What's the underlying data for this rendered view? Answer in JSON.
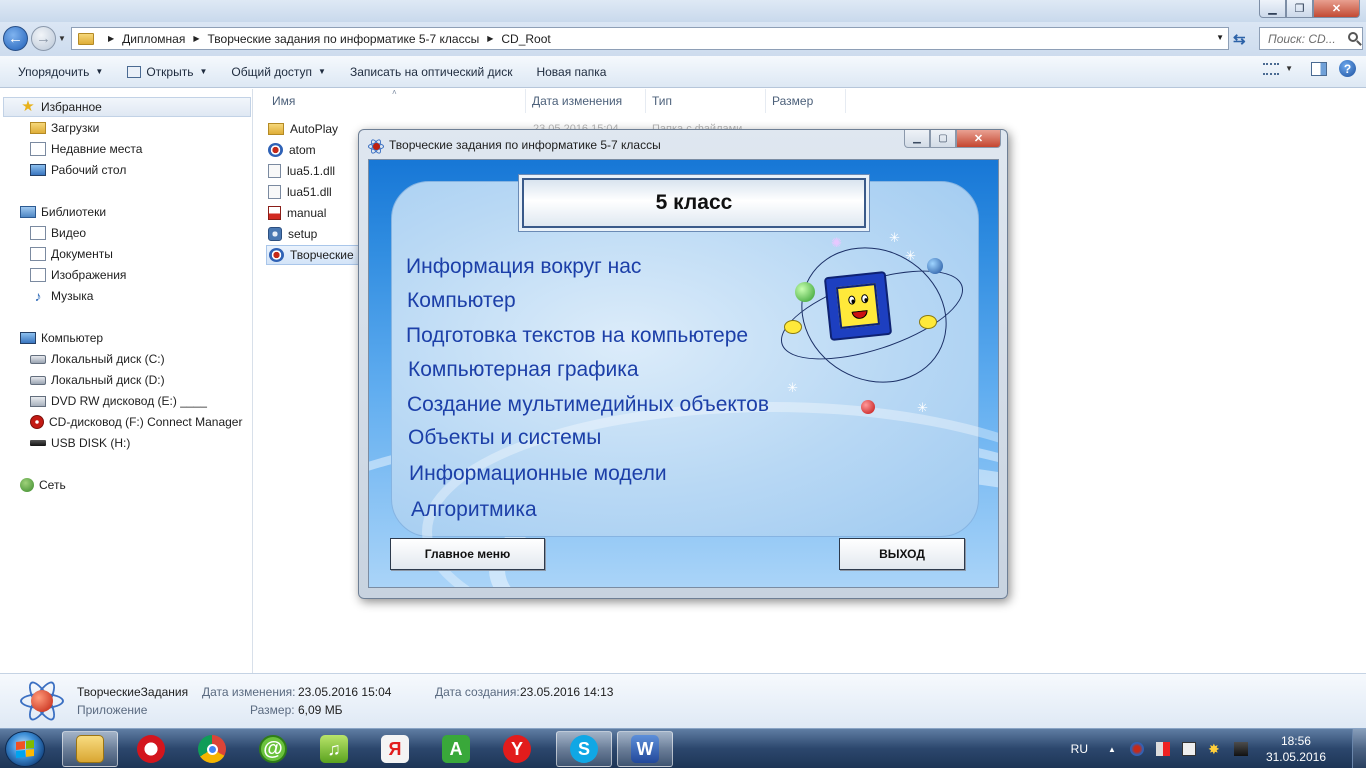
{
  "explorer": {
    "breadcrumb": [
      "Дипломная",
      "Творческие задания по информатике 5-7 классы",
      "CD_Root"
    ],
    "search_placeholder": "Поиск: CD...",
    "toolbar": {
      "organize": "Упорядочить",
      "open": "Открыть",
      "share": "Общий доступ",
      "burn": "Записать на оптический диск",
      "new_folder": "Новая папка"
    },
    "nav": {
      "favorites": "Избранное",
      "downloads": "Загрузки",
      "recent": "Недавние места",
      "desktop": "Рабочий стол",
      "libraries": "Библиотеки",
      "video": "Видео",
      "documents": "Документы",
      "images": "Изображения",
      "music": "Музыка",
      "computer": "Компьютер",
      "disk_c": "Локальный диск (C:)",
      "disk_d": "Локальный диск (D:)",
      "dvd": "DVD RW дисковод (E:) ____",
      "cd": "CD-дисковод (F:) Connect Manager",
      "usb": "USB DISK (H:)",
      "network": "Сеть"
    },
    "columns": {
      "name": "Имя",
      "modified": "Дата изменения",
      "type": "Тип",
      "size": "Размер"
    },
    "files": [
      {
        "name": "AutoPlay",
        "icon": "folder-icon"
      },
      {
        "name": "atom",
        "icon": "atom-icon"
      },
      {
        "name": "lua5.1.dll",
        "icon": "dll-icon"
      },
      {
        "name": "lua51.dll",
        "icon": "dll-icon"
      },
      {
        "name": "manual",
        "icon": "pdf-icon"
      },
      {
        "name": "setup",
        "icon": "setup-icon"
      },
      {
        "name": "Творческие",
        "icon": "atom-icon"
      }
    ],
    "autoplay_row": {
      "modified": "23.05.2016 15:04",
      "type": "Папка с файлами"
    },
    "details": {
      "name": "ТворческиеЗадания",
      "kind": "Приложение",
      "modified_label": "Дата изменения:",
      "modified_value": "23.05.2016 15:04",
      "created_label": "Дата создания:",
      "created_value": "23.05.2016 14:13",
      "size_label": "Размер:",
      "size_value": "6,09 МБ"
    }
  },
  "app": {
    "title": "Творческие задания по информатике 5-7 классы",
    "grade": "5 класс",
    "topics": [
      "Информация вокруг нас",
      "Компьютер",
      "Подготовка текстов на компьютере",
      "Компьютерная графика",
      "Создание мультимедийных объектов",
      "Объекты и системы",
      "Информационные модели",
      "Алгоритмика"
    ],
    "main_menu": "Главное меню",
    "exit": "ВЫХОД"
  },
  "taskbar": {
    "apps": [
      "windows-explorer",
      "opera",
      "chrome",
      "mail-ru-agent",
      "music-player",
      "yandex",
      "agent-a",
      "yandex-browser",
      "skype",
      "word"
    ],
    "language": "RU",
    "time": "18:56",
    "date": "31.05.2016"
  },
  "colors": {
    "app_topic_text": "#1c3fa8",
    "app_background": "#2f8ce0",
    "taskbar": "#2c476d"
  }
}
